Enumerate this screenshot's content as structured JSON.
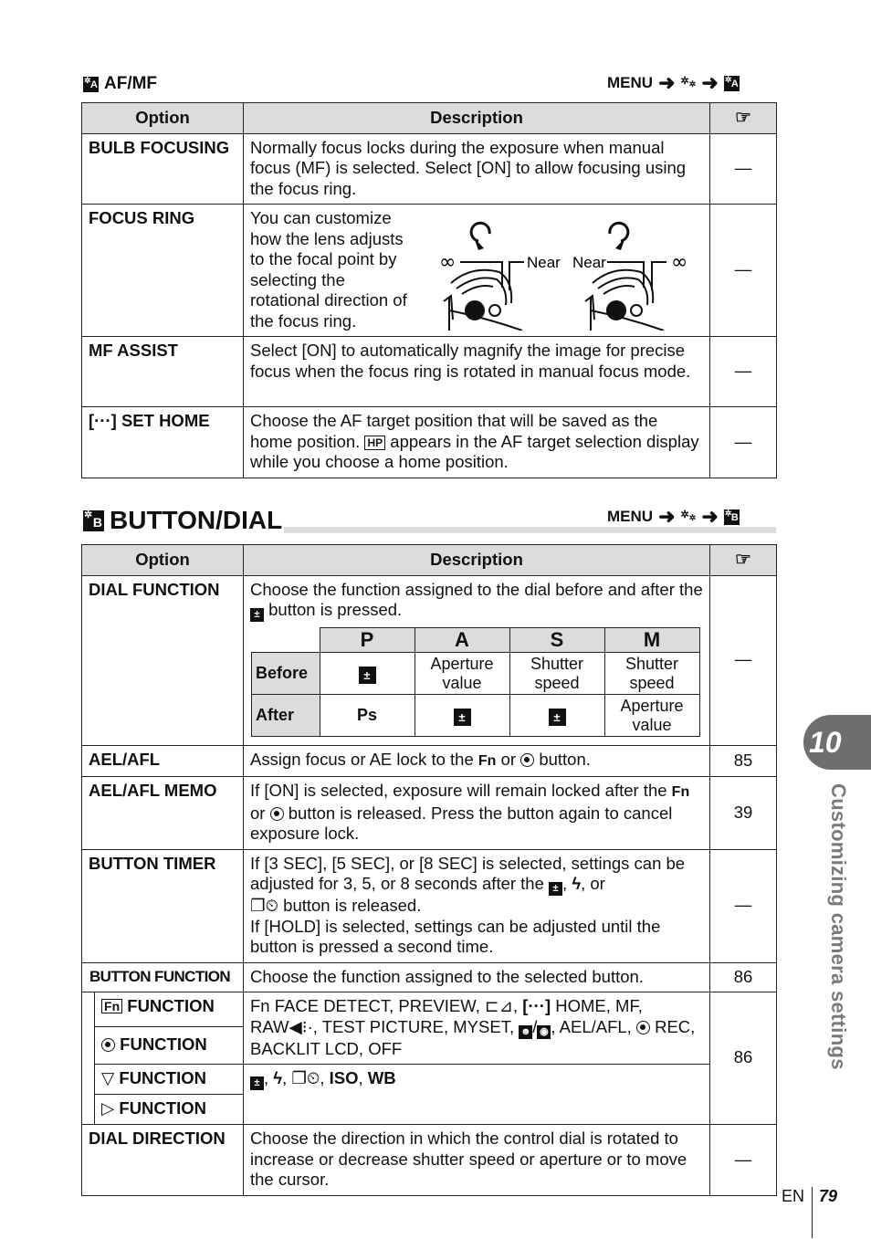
{
  "section_af_mf": {
    "icon": "custom-menu-a-icon",
    "icon_letter": "A",
    "title": "AF/MF",
    "menu_path": {
      "menu": "MENU",
      "steps": [
        "arrow-right-icon",
        "gears-icon",
        "arrow-right-icon",
        "custom-menu-a-icon"
      ]
    },
    "table": {
      "headers": {
        "option": "Option",
        "description": "Description",
        "ref_icon": "pointing-hand-icon"
      },
      "rows": [
        {
          "option": "BULB FOCUSING",
          "description": "Normally focus locks during the exposure when manual focus (MF) is selected. Select [ON] to allow focusing using the focus ring.",
          "ref": "—"
        },
        {
          "option": "FOCUS RING",
          "description": "You can customize how the lens adjusts to the focal point by selecting the rotational direction of the focus ring.",
          "ref": "—",
          "illustration": {
            "left": {
              "rotation": "clockwise",
              "label_left": "∞",
              "label_right": "Near"
            },
            "right": {
              "rotation": "counterclockwise",
              "label_left": "Near",
              "label_right": "∞"
            }
          }
        },
        {
          "option": "MF ASSIST",
          "description": "Select [ON] to automatically magnify the image for precise focus when the focus ring is rotated in manual focus mode.",
          "ref": "—"
        },
        {
          "option_icon": "af-target-icon",
          "option_icon_text": "[···]",
          "option": "SET HOME",
          "description_a": "Choose the AF target position that will be saved as the home position.",
          "hp_badge": "HP",
          "description_b": "appears in the AF target selection display while you choose a home position.",
          "ref": "—"
        }
      ]
    }
  },
  "section_button_dial": {
    "icon": "custom-menu-b-icon",
    "icon_letter": "B",
    "title": "BUTTON/DIAL",
    "menu_path": {
      "menu": "MENU",
      "steps": [
        "arrow-right-icon",
        "gears-icon",
        "arrow-right-icon",
        "custom-menu-b-icon"
      ]
    },
    "table": {
      "headers": {
        "option": "Option",
        "description": "Description",
        "ref_icon": "pointing-hand-icon"
      },
      "dial_function": {
        "option": "DIAL FUNCTION",
        "description_a": "Choose the function assigned to the dial before and after the",
        "description_b": "button is pressed.",
        "ref": "—",
        "mode_table": {
          "modes": [
            "P",
            "A",
            "S",
            "M"
          ],
          "rows": [
            {
              "label": "Before",
              "cells": [
                "exposure-compensation-icon",
                "Aperture value",
                "Shutter speed",
                "Shutter speed"
              ]
            },
            {
              "label": "After",
              "cells": [
                "Ps",
                "exposure-compensation-icon",
                "exposure-compensation-icon",
                "Aperture value"
              ]
            }
          ]
        }
      },
      "ael_afl": {
        "option": "AEL/AFL",
        "description_a": "Assign focus or AE lock to the",
        "fn": "Fn",
        "or": "or",
        "description_b": "button.",
        "ref": "85"
      },
      "ael_afl_memo": {
        "option": "AEL/AFL MEMO",
        "description_a": "If [ON] is selected, exposure will remain locked after the",
        "fn": "Fn",
        "or": "or",
        "description_b": "button is released. Press the button again to cancel exposure lock.",
        "ref": "39"
      },
      "button_timer": {
        "option": "BUTTON TIMER",
        "description_a": "If [3 SEC], [5 SEC], or [8 SEC] is selected, settings can be adjusted for 3, 5, or 8 seconds after the",
        "description_b": ", or",
        "description_c": "button is released.",
        "description_d": "If [HOLD] is selected, settings can be adjusted until the button is pressed a second time.",
        "ref": "—"
      },
      "button_function": {
        "option": "BUTTON FUNCTION",
        "description": "Choose the function assigned to the selected button.",
        "ref": "86",
        "sub": [
          {
            "icon": "fn-button-icon",
            "icon_text": "Fn",
            "label": "FUNCTION"
          },
          {
            "icon": "rec-button-icon",
            "label": "FUNCTION"
          },
          {
            "icon": "down-triangle-icon",
            "icon_text": "▽",
            "label": "FUNCTION"
          },
          {
            "icon": "right-triangle-icon",
            "icon_text": "▷",
            "label": "FUNCTION"
          }
        ],
        "group1_text": {
          "a": "Fn FACE DETECT, PREVIEW,",
          "b": "HOME, MF,",
          "c": "RAW",
          "d": ", TEST PICTURE, MYSET,",
          "e": ", AEL/AFL,",
          "f": "REC, BACKLIT LCD, OFF"
        },
        "group2_text": {
          "iso": "ISO",
          "wb": "WB"
        }
      },
      "dial_direction": {
        "option": "DIAL DIRECTION",
        "description": "Choose the direction in which the control dial is rotated to increase or decrease shutter speed or aperture or to move the cursor.",
        "ref": "—"
      }
    }
  },
  "chapter_tab": {
    "number": "10",
    "label": "Customizing camera settings",
    "color": "#6e6e6e"
  },
  "footer": {
    "lang": "EN",
    "page": "79"
  }
}
